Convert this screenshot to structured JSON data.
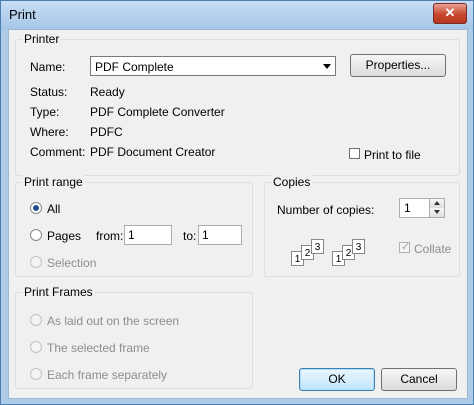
{
  "window": {
    "title": "Print",
    "close_glyph": "✕"
  },
  "printer": {
    "legend": "Printer",
    "name_label": "Name:",
    "name_value": "PDF Complete",
    "properties_label": "Properties...",
    "status_label": "Status:",
    "status_value": "Ready",
    "type_label": "Type:",
    "type_value": "PDF Complete Converter",
    "where_label": "Where:",
    "where_value": "PDFC",
    "comment_label": "Comment:",
    "comment_value": "PDF Document Creator",
    "print_to_file_label": "Print to file",
    "print_to_file_checked": false
  },
  "print_range": {
    "legend": "Print range",
    "all_label": "All",
    "pages_label": "Pages",
    "from_label": "from:",
    "from_value": "1",
    "to_label": "to:",
    "to_value": "1",
    "selection_label": "Selection",
    "selected": "all"
  },
  "copies": {
    "legend": "Copies",
    "number_label": "Number of copies:",
    "number_value": "1",
    "collate_label": "Collate",
    "collate_checked": true,
    "collate_icon_pages": [
      "1",
      "2",
      "3"
    ]
  },
  "print_frames": {
    "legend": "Print Frames",
    "options": [
      {
        "label": "As laid out on the screen"
      },
      {
        "label": "The selected frame"
      },
      {
        "label": "Each frame separately"
      }
    ]
  },
  "buttons": {
    "ok_label": "OK",
    "cancel_label": "Cancel"
  }
}
